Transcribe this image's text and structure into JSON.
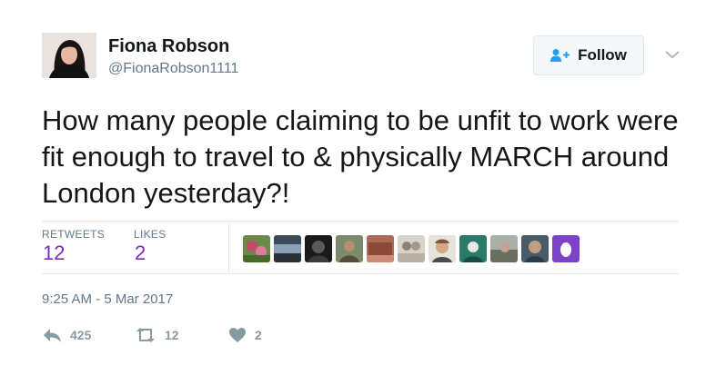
{
  "user": {
    "name": "Fiona Robson",
    "handle": "@FionaRobson1111"
  },
  "follow_button": {
    "label": "Follow",
    "icon": "add-person-icon"
  },
  "tweet": {
    "text": "How many people claiming to be unfit to work were fit enough to travel to & physically MARCH around London yesterday?!",
    "timestamp": "9:25 AM - 5 Mar 2017"
  },
  "stats": {
    "retweets_label": "RETWEETS",
    "retweets_value": "12",
    "likes_label": "LIKES",
    "likes_value": "2"
  },
  "actions": {
    "reply_count": "425",
    "retweet_count": "12",
    "like_count": "2"
  },
  "colors": {
    "accent_purple": "#7b2bbf",
    "muted_text": "#657786",
    "action_icon": "#8899a6",
    "follow_icon": "#1da1f2"
  }
}
